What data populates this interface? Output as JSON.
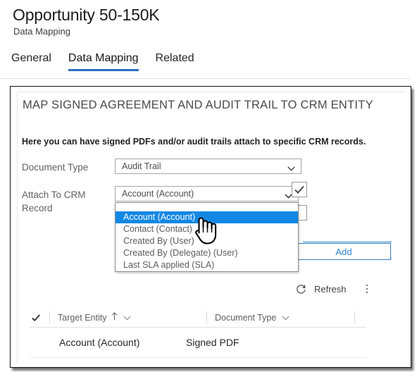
{
  "header": {
    "title": "Opportunity 50-150K",
    "subtitle": "Data Mapping",
    "tabs": [
      {
        "label": "General",
        "active": false
      },
      {
        "label": "Data Mapping",
        "active": true
      },
      {
        "label": "Related",
        "active": false
      }
    ]
  },
  "panel": {
    "section_title": "MAP SIGNED AGREEMENT AND AUDIT TRAIL TO CRM ENTITY",
    "description": "Here you can have signed PDFs and/or audit trails attach to specific CRM records.",
    "fields": {
      "document_type": {
        "label": "Document Type",
        "value": "Audit Trail"
      },
      "attach_to_crm_record": {
        "label": "Attach To CRM Record",
        "value": "Account (Account)",
        "options": [
          "",
          "Account (Account)",
          "Contact (Contact)",
          "Created By (User)",
          "Created By (Delegate) (User)",
          "Last SLA applied (SLA)"
        ],
        "selected_option": "Account (Account)",
        "expanded": true
      }
    },
    "add_button_label": "Add"
  },
  "commandbar": {
    "refresh_label": "Refresh",
    "overflow_label": "More commands"
  },
  "grid": {
    "columns": [
      {
        "label": "Target Entity",
        "sorted": "ascending"
      },
      {
        "label": "Document Type",
        "sorted": "none"
      }
    ],
    "rows": [
      {
        "target_entity": "Account (Account)",
        "document_type": "Signed PDF"
      }
    ]
  },
  "colors": {
    "accent_blue": "#2a6fc4",
    "highlight_blue": "#1288e4",
    "link_blue": "#2b7fc6",
    "text_primary": "#1b1b1b",
    "text_secondary": "#616161"
  }
}
